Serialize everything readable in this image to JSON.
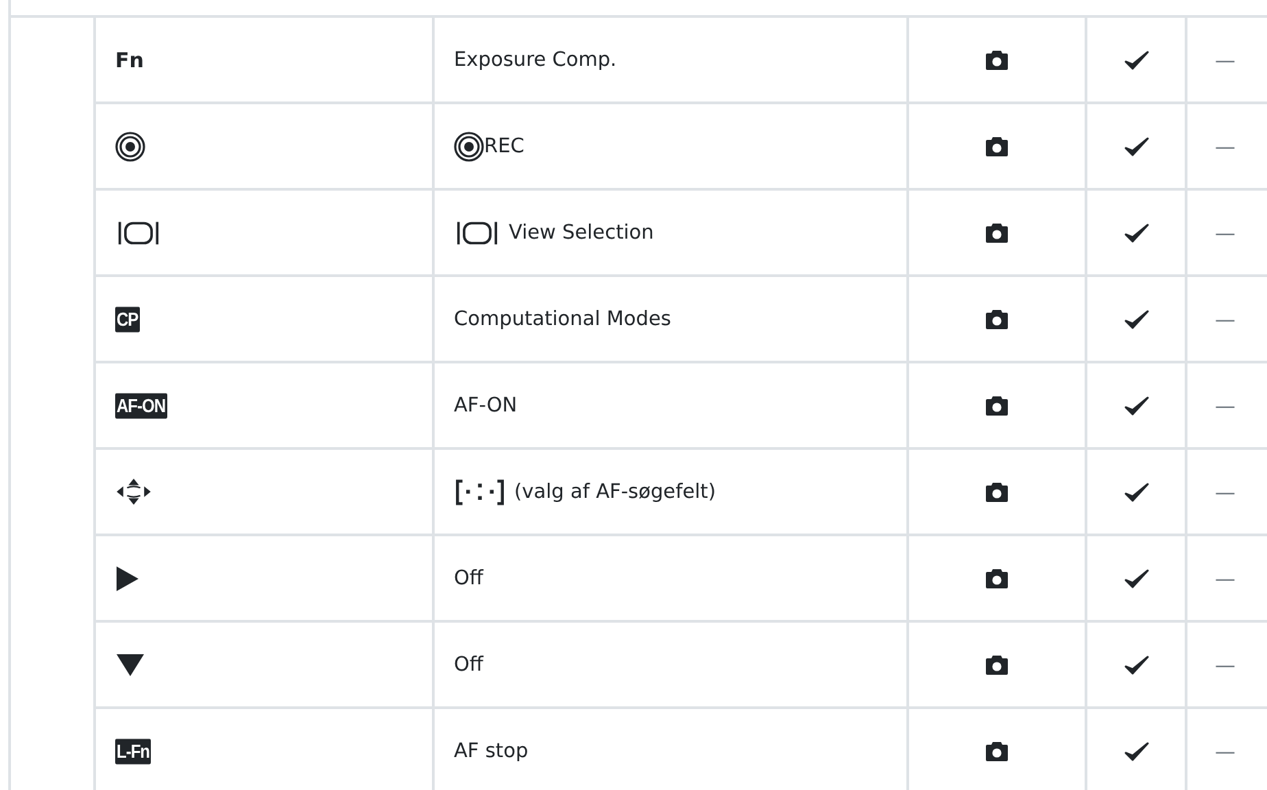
{
  "rows": [
    {
      "button": {
        "kind": "text",
        "text": "Fn"
      },
      "function": {
        "kind": "text",
        "text": "Exposure Comp."
      },
      "checked": true,
      "column_6": "—"
    },
    {
      "button": {
        "kind": "rec"
      },
      "function": {
        "kind": "rec",
        "text": "REC"
      },
      "checked": true,
      "column_6": "—"
    },
    {
      "button": {
        "kind": "view"
      },
      "function": {
        "kind": "view",
        "text": "View Selection"
      },
      "checked": true,
      "column_6": "—"
    },
    {
      "button": {
        "kind": "badge",
        "text": "CP"
      },
      "function": {
        "kind": "text",
        "text": "Computational Modes"
      },
      "checked": true,
      "column_6": "—"
    },
    {
      "button": {
        "kind": "badge",
        "text": "AF-ON"
      },
      "function": {
        "kind": "text",
        "text": "AF-ON"
      },
      "checked": true,
      "column_6": "—"
    },
    {
      "button": {
        "kind": "arrows"
      },
      "function": {
        "kind": "target",
        "text": "(valg af AF-søgefelt)"
      },
      "checked": true,
      "column_6": "—"
    },
    {
      "button": {
        "kind": "right"
      },
      "function": {
        "kind": "text",
        "text": "Off"
      },
      "checked": true,
      "column_6": "—"
    },
    {
      "button": {
        "kind": "down"
      },
      "function": {
        "kind": "text",
        "text": "Off"
      },
      "checked": true,
      "column_6": "—"
    },
    {
      "button": {
        "kind": "badge",
        "text": "L-Fn"
      },
      "function": {
        "kind": "text",
        "text": "AF stop"
      },
      "checked": true,
      "column_6": "—"
    }
  ]
}
